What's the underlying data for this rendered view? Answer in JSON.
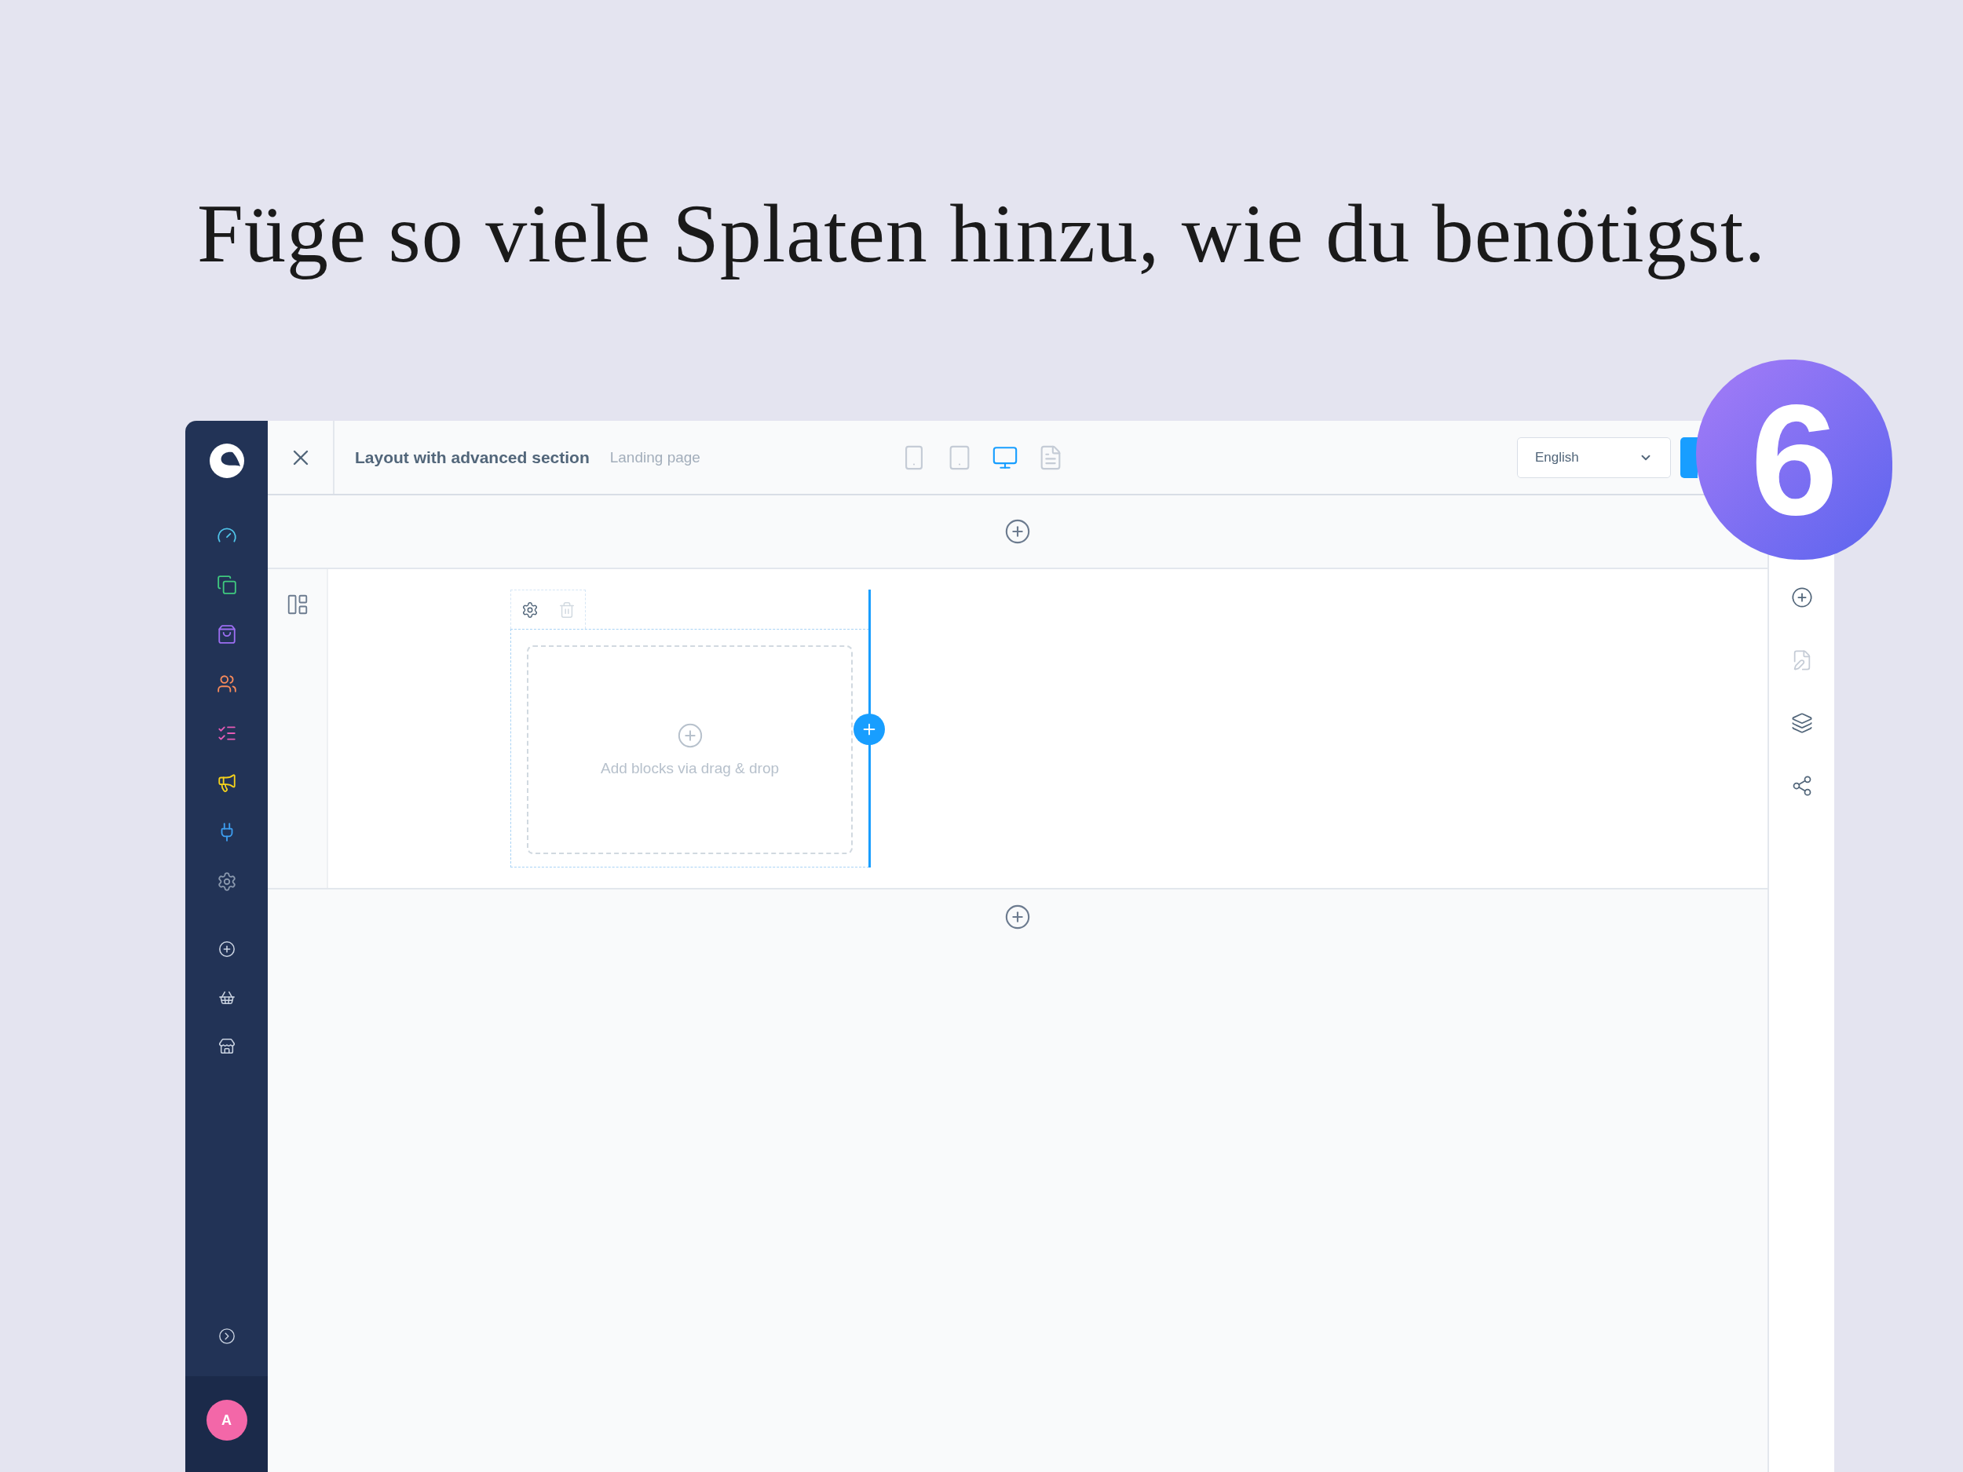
{
  "headline": "Füge so viele Splaten hinzu, wie du benötigst.",
  "badge": {
    "label": "6"
  },
  "sidebar": {
    "items": [
      {
        "kind": "dashboard",
        "color": "#4fc3e8"
      },
      {
        "kind": "catalogue",
        "color": "#3fc97f"
      },
      {
        "kind": "orders",
        "color": "#9c6ef2"
      },
      {
        "kind": "customers",
        "color": "#f68a5b"
      },
      {
        "kind": "content",
        "color": "#e55ab5"
      },
      {
        "kind": "marketing",
        "color": "#f5d21b"
      },
      {
        "kind": "extensions",
        "color": "#3d9ef0"
      },
      {
        "kind": "settings",
        "color": "#8a98ad"
      }
    ],
    "shortcuts": [
      {
        "kind": "add"
      },
      {
        "kind": "sales-channel"
      },
      {
        "kind": "storefront"
      }
    ],
    "avatar": "A"
  },
  "header": {
    "title": "Layout with advanced section",
    "subtitle": "Landing page",
    "devices": [
      {
        "kind": "mobile",
        "selected": false
      },
      {
        "kind": "tablet",
        "selected": false
      },
      {
        "kind": "desktop",
        "selected": true
      },
      {
        "kind": "form",
        "selected": false
      }
    ],
    "language": "English"
  },
  "canvas": {
    "dropzone_text": "Add blocks via drag & drop"
  },
  "side_panel": {
    "tools": [
      {
        "kind": "add"
      },
      {
        "kind": "edit"
      },
      {
        "kind": "layers"
      },
      {
        "kind": "share"
      }
    ]
  }
}
